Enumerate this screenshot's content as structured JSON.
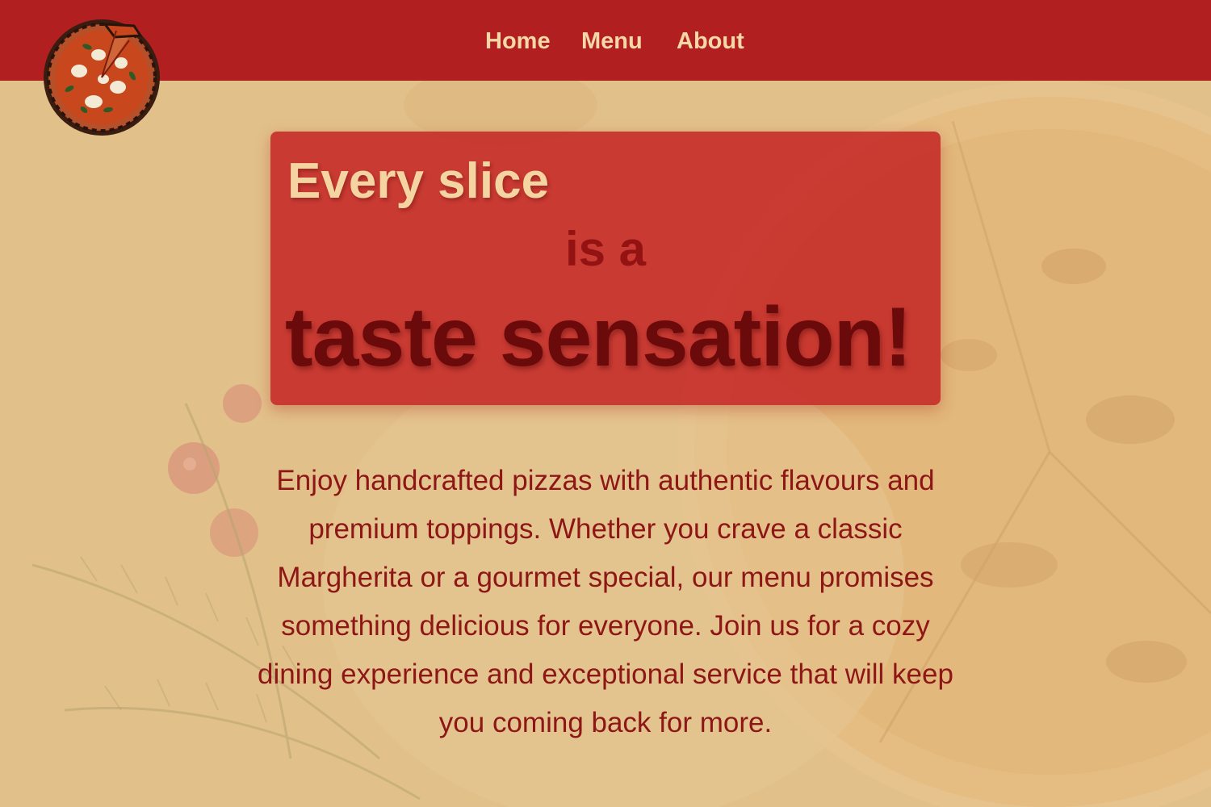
{
  "nav": {
    "items": [
      {
        "label": "Home"
      },
      {
        "label": "Menu"
      },
      {
        "label": "About"
      }
    ]
  },
  "logo": {
    "icon": "pizza-logo-icon"
  },
  "hero": {
    "line1": "Every slice",
    "line2": "is a",
    "line3": "taste sensation!"
  },
  "intro": {
    "text": "Enjoy handcrafted pizzas with authentic flavours and premium toppings. Whether you crave a classic Margherita or a gourmet special, our menu promises something delicious for everyone. Join us for a cozy dining experience and exceptional service that will keep you coming back for more."
  },
  "colors": {
    "header": "#b21f21",
    "nav_text": "#f6d8a8",
    "hero_box": "#c42424",
    "hero_line1": "#f4d4a0",
    "hero_line2": "#931212",
    "hero_line3": "#6b0a0a",
    "body_text": "#8e1616",
    "background": "#e2c08a"
  }
}
